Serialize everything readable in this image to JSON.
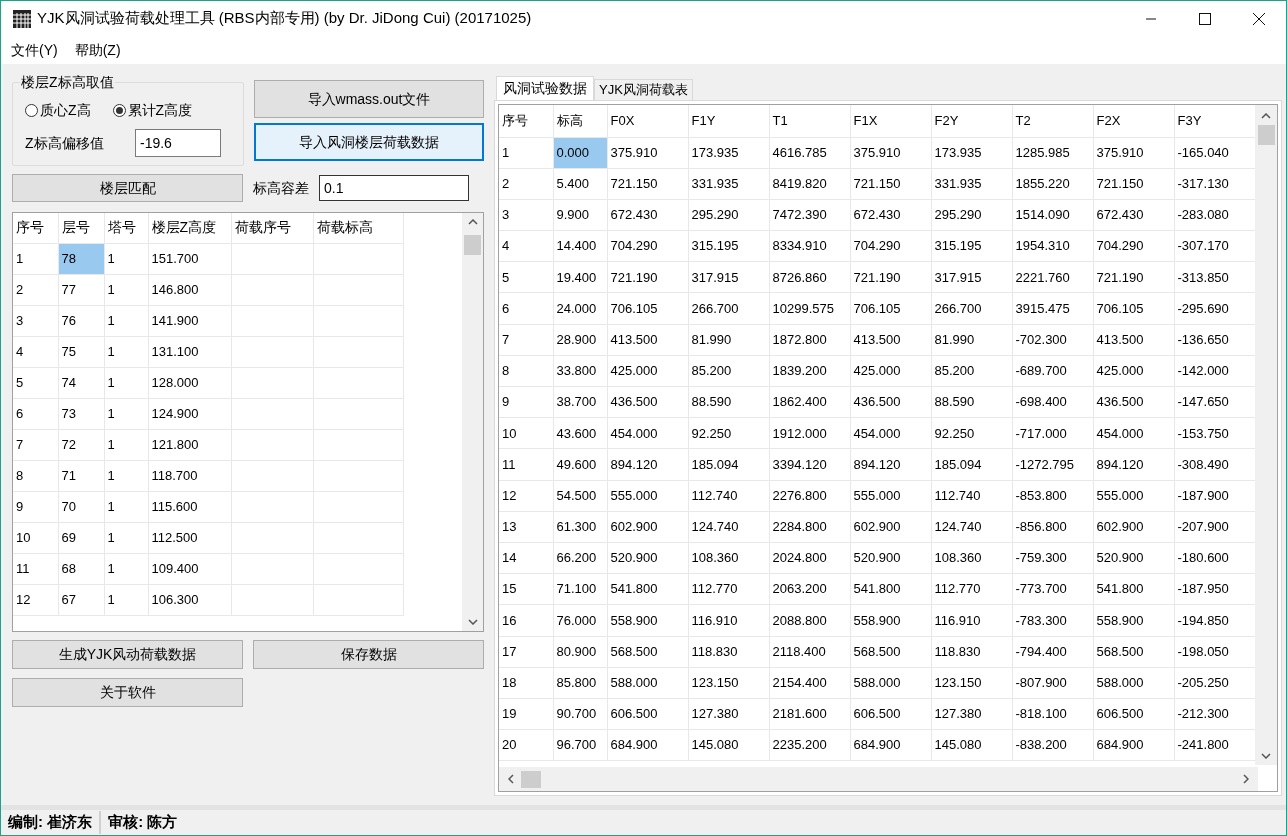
{
  "window": {
    "title": "YJK风洞试验荷载处理工具 (RBS内部专用) (by Dr. JiDong Cui) (20171025)"
  },
  "menu": [
    "文件(Y)",
    "帮助(Z)"
  ],
  "z_group": {
    "title": "楼层Z标高取值",
    "options": [
      {
        "label": "质心Z高",
        "selected": false
      },
      {
        "label": "累计Z高度",
        "selected": true
      }
    ],
    "offset_label": "Z标高偏移值",
    "offset_value": "-19.6"
  },
  "import_buttons": [
    {
      "label": "导入wmass.out文件",
      "focused": false
    },
    {
      "label": "导入风洞楼层荷载数据",
      "focused": true
    }
  ],
  "match_button": "楼层匹配",
  "tolerance": {
    "label": "标高容差",
    "value": "0.1"
  },
  "floor_table": {
    "columns": [
      "序号",
      "层号",
      "塔号",
      "楼层Z高度",
      "荷载序号",
      "荷载标高"
    ],
    "rows": [
      [
        {
          "text": "1",
          "selected": false
        },
        {
          "text": "78",
          "selected": true
        },
        {
          "text": "1",
          "selected": false
        },
        {
          "text": "151.700",
          "selected": false
        },
        {
          "text": "",
          "selected": false
        },
        {
          "text": "",
          "selected": false
        }
      ],
      [
        {
          "text": "2",
          "selected": false
        },
        {
          "text": "77",
          "selected": false
        },
        {
          "text": "1",
          "selected": false
        },
        {
          "text": "146.800",
          "selected": false
        },
        {
          "text": "",
          "selected": false
        },
        {
          "text": "",
          "selected": false
        }
      ],
      [
        {
          "text": "3",
          "selected": false
        },
        {
          "text": "76",
          "selected": false
        },
        {
          "text": "1",
          "selected": false
        },
        {
          "text": "141.900",
          "selected": false
        },
        {
          "text": "",
          "selected": false
        },
        {
          "text": "",
          "selected": false
        }
      ],
      [
        {
          "text": "4",
          "selected": false
        },
        {
          "text": "75",
          "selected": false
        },
        {
          "text": "1",
          "selected": false
        },
        {
          "text": "131.100",
          "selected": false
        },
        {
          "text": "",
          "selected": false
        },
        {
          "text": "",
          "selected": false
        }
      ],
      [
        {
          "text": "5",
          "selected": false
        },
        {
          "text": "74",
          "selected": false
        },
        {
          "text": "1",
          "selected": false
        },
        {
          "text": "128.000",
          "selected": false
        },
        {
          "text": "",
          "selected": false
        },
        {
          "text": "",
          "selected": false
        }
      ],
      [
        {
          "text": "6",
          "selected": false
        },
        {
          "text": "73",
          "selected": false
        },
        {
          "text": "1",
          "selected": false
        },
        {
          "text": "124.900",
          "selected": false
        },
        {
          "text": "",
          "selected": false
        },
        {
          "text": "",
          "selected": false
        }
      ],
      [
        {
          "text": "7",
          "selected": false
        },
        {
          "text": "72",
          "selected": false
        },
        {
          "text": "1",
          "selected": false
        },
        {
          "text": "121.800",
          "selected": false
        },
        {
          "text": "",
          "selected": false
        },
        {
          "text": "",
          "selected": false
        }
      ],
      [
        {
          "text": "8",
          "selected": false
        },
        {
          "text": "71",
          "selected": false
        },
        {
          "text": "1",
          "selected": false
        },
        {
          "text": "118.700",
          "selected": false
        },
        {
          "text": "",
          "selected": false
        },
        {
          "text": "",
          "selected": false
        }
      ],
      [
        {
          "text": "9",
          "selected": false
        },
        {
          "text": "70",
          "selected": false
        },
        {
          "text": "1",
          "selected": false
        },
        {
          "text": "115.600",
          "selected": false
        },
        {
          "text": "",
          "selected": false
        },
        {
          "text": "",
          "selected": false
        }
      ],
      [
        {
          "text": "10",
          "selected": false
        },
        {
          "text": "69",
          "selected": false
        },
        {
          "text": "1",
          "selected": false
        },
        {
          "text": "112.500",
          "selected": false
        },
        {
          "text": "",
          "selected": false
        },
        {
          "text": "",
          "selected": false
        }
      ],
      [
        {
          "text": "11",
          "selected": false
        },
        {
          "text": "68",
          "selected": false
        },
        {
          "text": "1",
          "selected": false
        },
        {
          "text": "109.400",
          "selected": false
        },
        {
          "text": "",
          "selected": false
        },
        {
          "text": "",
          "selected": false
        }
      ],
      [
        {
          "text": "12",
          "selected": false
        },
        {
          "text": "67",
          "selected": false
        },
        {
          "text": "1",
          "selected": false
        },
        {
          "text": "106.300",
          "selected": false
        },
        {
          "text": "",
          "selected": false
        },
        {
          "text": "",
          "selected": false
        }
      ]
    ]
  },
  "action_buttons": [
    "生成YJK风动荷载数据",
    "保存数据",
    "关于软件"
  ],
  "tabs": [
    {
      "label": "风洞试验数据",
      "selected": true
    },
    {
      "label": "YJK风洞荷载表",
      "selected": false
    }
  ],
  "wind_table": {
    "columns": [
      "序号",
      "标高",
      "F0X",
      "F1Y",
      "T1",
      "F1X",
      "F2Y",
      "T2",
      "F2X",
      "F3Y"
    ],
    "rows": [
      [
        "1",
        "0.000",
        "375.910",
        "173.935",
        "4616.785",
        "375.910",
        "173.935",
        "1285.985",
        "375.910",
        "-165.040"
      ],
      [
        "2",
        "5.400",
        "721.150",
        "331.935",
        "8419.820",
        "721.150",
        "331.935",
        "1855.220",
        "721.150",
        "-317.130"
      ],
      [
        "3",
        "9.900",
        "672.430",
        "295.290",
        "7472.390",
        "672.430",
        "295.290",
        "1514.090",
        "672.430",
        "-283.080"
      ],
      [
        "4",
        "14.400",
        "704.290",
        "315.195",
        "8334.910",
        "704.290",
        "315.195",
        "1954.310",
        "704.290",
        "-307.170"
      ],
      [
        "5",
        "19.400",
        "721.190",
        "317.915",
        "8726.860",
        "721.190",
        "317.915",
        "2221.760",
        "721.190",
        "-313.850"
      ],
      [
        "6",
        "24.000",
        "706.105",
        "266.700",
        "10299.575",
        "706.105",
        "266.700",
        "3915.475",
        "706.105",
        "-295.690"
      ],
      [
        "7",
        "28.900",
        "413.500",
        "81.990",
        "1872.800",
        "413.500",
        "81.990",
        "-702.300",
        "413.500",
        "-136.650"
      ],
      [
        "8",
        "33.800",
        "425.000",
        "85.200",
        "1839.200",
        "425.000",
        "85.200",
        "-689.700",
        "425.000",
        "-142.000"
      ],
      [
        "9",
        "38.700",
        "436.500",
        "88.590",
        "1862.400",
        "436.500",
        "88.590",
        "-698.400",
        "436.500",
        "-147.650"
      ],
      [
        "10",
        "43.600",
        "454.000",
        "92.250",
        "1912.000",
        "454.000",
        "92.250",
        "-717.000",
        "454.000",
        "-153.750"
      ],
      [
        "11",
        "49.600",
        "894.120",
        "185.094",
        "3394.120",
        "894.120",
        "185.094",
        "-1272.795",
        "894.120",
        "-308.490"
      ],
      [
        "12",
        "54.500",
        "555.000",
        "112.740",
        "2276.800",
        "555.000",
        "112.740",
        "-853.800",
        "555.000",
        "-187.900"
      ],
      [
        "13",
        "61.300",
        "602.900",
        "124.740",
        "2284.800",
        "602.900",
        "124.740",
        "-856.800",
        "602.900",
        "-207.900"
      ],
      [
        "14",
        "66.200",
        "520.900",
        "108.360",
        "2024.800",
        "520.900",
        "108.360",
        "-759.300",
        "520.900",
        "-180.600"
      ],
      [
        "15",
        "71.100",
        "541.800",
        "112.770",
        "2063.200",
        "541.800",
        "112.770",
        "-773.700",
        "541.800",
        "-187.950"
      ],
      [
        "16",
        "76.000",
        "558.900",
        "116.910",
        "2088.800",
        "558.900",
        "116.910",
        "-783.300",
        "558.900",
        "-194.850"
      ],
      [
        "17",
        "80.900",
        "568.500",
        "118.830",
        "2118.400",
        "568.500",
        "118.830",
        "-794.400",
        "568.500",
        "-198.050"
      ],
      [
        "18",
        "85.800",
        "588.000",
        "123.150",
        "2154.400",
        "588.000",
        "123.150",
        "-807.900",
        "588.000",
        "-205.250"
      ],
      [
        "19",
        "90.700",
        "606.500",
        "127.380",
        "2181.600",
        "606.500",
        "127.380",
        "-818.100",
        "606.500",
        "-212.300"
      ],
      [
        "20",
        "96.700",
        "684.900",
        "145.080",
        "2235.200",
        "684.900",
        "145.080",
        "-838.200",
        "684.900",
        "-241.800"
      ]
    ],
    "selected": [
      [
        false,
        true,
        false,
        false,
        false,
        false,
        false,
        false,
        false,
        false
      ],
      [
        false,
        false,
        false,
        false,
        false,
        false,
        false,
        false,
        false,
        false
      ],
      [
        false,
        false,
        false,
        false,
        false,
        false,
        false,
        false,
        false,
        false
      ],
      [
        false,
        false,
        false,
        false,
        false,
        false,
        false,
        false,
        false,
        false
      ],
      [
        false,
        false,
        false,
        false,
        false,
        false,
        false,
        false,
        false,
        false
      ],
      [
        false,
        false,
        false,
        false,
        false,
        false,
        false,
        false,
        false,
        false
      ],
      [
        false,
        false,
        false,
        false,
        false,
        false,
        false,
        false,
        false,
        false
      ],
      [
        false,
        false,
        false,
        false,
        false,
        false,
        false,
        false,
        false,
        false
      ],
      [
        false,
        false,
        false,
        false,
        false,
        false,
        false,
        false,
        false,
        false
      ],
      [
        false,
        false,
        false,
        false,
        false,
        false,
        false,
        false,
        false,
        false
      ],
      [
        false,
        false,
        false,
        false,
        false,
        false,
        false,
        false,
        false,
        false
      ],
      [
        false,
        false,
        false,
        false,
        false,
        false,
        false,
        false,
        false,
        false
      ],
      [
        false,
        false,
        false,
        false,
        false,
        false,
        false,
        false,
        false,
        false
      ],
      [
        false,
        false,
        false,
        false,
        false,
        false,
        false,
        false,
        false,
        false
      ],
      [
        false,
        false,
        false,
        false,
        false,
        false,
        false,
        false,
        false,
        false
      ],
      [
        false,
        false,
        false,
        false,
        false,
        false,
        false,
        false,
        false,
        false
      ],
      [
        false,
        false,
        false,
        false,
        false,
        false,
        false,
        false,
        false,
        false
      ],
      [
        false,
        false,
        false,
        false,
        false,
        false,
        false,
        false,
        false,
        false
      ],
      [
        false,
        false,
        false,
        false,
        false,
        false,
        false,
        false,
        false,
        false
      ],
      [
        false,
        false,
        false,
        false,
        false,
        false,
        false,
        false,
        false,
        false
      ]
    ]
  },
  "status_bar": [
    "编制: 崔济东",
    "审核: 陈方"
  ]
}
